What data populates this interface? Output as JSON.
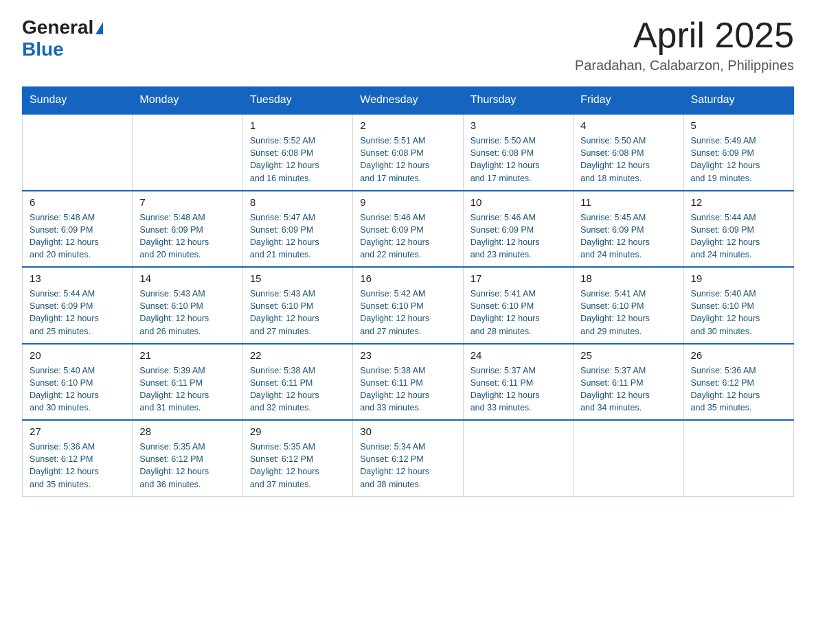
{
  "logo": {
    "text_general": "General",
    "triangle": "▲",
    "text_blue": "Blue"
  },
  "title": "April 2025",
  "subtitle": "Paradahan, Calabarzon, Philippines",
  "days_of_week": [
    "Sunday",
    "Monday",
    "Tuesday",
    "Wednesday",
    "Thursday",
    "Friday",
    "Saturday"
  ],
  "weeks": [
    [
      {
        "day": "",
        "info": ""
      },
      {
        "day": "",
        "info": ""
      },
      {
        "day": "1",
        "sunrise": "5:52 AM",
        "sunset": "6:08 PM",
        "daylight": "12 hours and 16 minutes."
      },
      {
        "day": "2",
        "sunrise": "5:51 AM",
        "sunset": "6:08 PM",
        "daylight": "12 hours and 17 minutes."
      },
      {
        "day": "3",
        "sunrise": "5:50 AM",
        "sunset": "6:08 PM",
        "daylight": "12 hours and 17 minutes."
      },
      {
        "day": "4",
        "sunrise": "5:50 AM",
        "sunset": "6:08 PM",
        "daylight": "12 hours and 18 minutes."
      },
      {
        "day": "5",
        "sunrise": "5:49 AM",
        "sunset": "6:09 PM",
        "daylight": "12 hours and 19 minutes."
      }
    ],
    [
      {
        "day": "6",
        "sunrise": "5:48 AM",
        "sunset": "6:09 PM",
        "daylight": "12 hours and 20 minutes."
      },
      {
        "day": "7",
        "sunrise": "5:48 AM",
        "sunset": "6:09 PM",
        "daylight": "12 hours and 20 minutes."
      },
      {
        "day": "8",
        "sunrise": "5:47 AM",
        "sunset": "6:09 PM",
        "daylight": "12 hours and 21 minutes."
      },
      {
        "day": "9",
        "sunrise": "5:46 AM",
        "sunset": "6:09 PM",
        "daylight": "12 hours and 22 minutes."
      },
      {
        "day": "10",
        "sunrise": "5:46 AM",
        "sunset": "6:09 PM",
        "daylight": "12 hours and 23 minutes."
      },
      {
        "day": "11",
        "sunrise": "5:45 AM",
        "sunset": "6:09 PM",
        "daylight": "12 hours and 24 minutes."
      },
      {
        "day": "12",
        "sunrise": "5:44 AM",
        "sunset": "6:09 PM",
        "daylight": "12 hours and 24 minutes."
      }
    ],
    [
      {
        "day": "13",
        "sunrise": "5:44 AM",
        "sunset": "6:09 PM",
        "daylight": "12 hours and 25 minutes."
      },
      {
        "day": "14",
        "sunrise": "5:43 AM",
        "sunset": "6:10 PM",
        "daylight": "12 hours and 26 minutes."
      },
      {
        "day": "15",
        "sunrise": "5:43 AM",
        "sunset": "6:10 PM",
        "daylight": "12 hours and 27 minutes."
      },
      {
        "day": "16",
        "sunrise": "5:42 AM",
        "sunset": "6:10 PM",
        "daylight": "12 hours and 27 minutes."
      },
      {
        "day": "17",
        "sunrise": "5:41 AM",
        "sunset": "6:10 PM",
        "daylight": "12 hours and 28 minutes."
      },
      {
        "day": "18",
        "sunrise": "5:41 AM",
        "sunset": "6:10 PM",
        "daylight": "12 hours and 29 minutes."
      },
      {
        "day": "19",
        "sunrise": "5:40 AM",
        "sunset": "6:10 PM",
        "daylight": "12 hours and 30 minutes."
      }
    ],
    [
      {
        "day": "20",
        "sunrise": "5:40 AM",
        "sunset": "6:10 PM",
        "daylight": "12 hours and 30 minutes."
      },
      {
        "day": "21",
        "sunrise": "5:39 AM",
        "sunset": "6:11 PM",
        "daylight": "12 hours and 31 minutes."
      },
      {
        "day": "22",
        "sunrise": "5:38 AM",
        "sunset": "6:11 PM",
        "daylight": "12 hours and 32 minutes."
      },
      {
        "day": "23",
        "sunrise": "5:38 AM",
        "sunset": "6:11 PM",
        "daylight": "12 hours and 33 minutes."
      },
      {
        "day": "24",
        "sunrise": "5:37 AM",
        "sunset": "6:11 PM",
        "daylight": "12 hours and 33 minutes."
      },
      {
        "day": "25",
        "sunrise": "5:37 AM",
        "sunset": "6:11 PM",
        "daylight": "12 hours and 34 minutes."
      },
      {
        "day": "26",
        "sunrise": "5:36 AM",
        "sunset": "6:12 PM",
        "daylight": "12 hours and 35 minutes."
      }
    ],
    [
      {
        "day": "27",
        "sunrise": "5:36 AM",
        "sunset": "6:12 PM",
        "daylight": "12 hours and 35 minutes."
      },
      {
        "day": "28",
        "sunrise": "5:35 AM",
        "sunset": "6:12 PM",
        "daylight": "12 hours and 36 minutes."
      },
      {
        "day": "29",
        "sunrise": "5:35 AM",
        "sunset": "6:12 PM",
        "daylight": "12 hours and 37 minutes."
      },
      {
        "day": "30",
        "sunrise": "5:34 AM",
        "sunset": "6:12 PM",
        "daylight": "12 hours and 38 minutes."
      },
      {
        "day": "",
        "info": ""
      },
      {
        "day": "",
        "info": ""
      },
      {
        "day": "",
        "info": ""
      }
    ]
  ],
  "labels": {
    "sunrise": "Sunrise:",
    "sunset": "Sunset:",
    "daylight": "Daylight:"
  }
}
